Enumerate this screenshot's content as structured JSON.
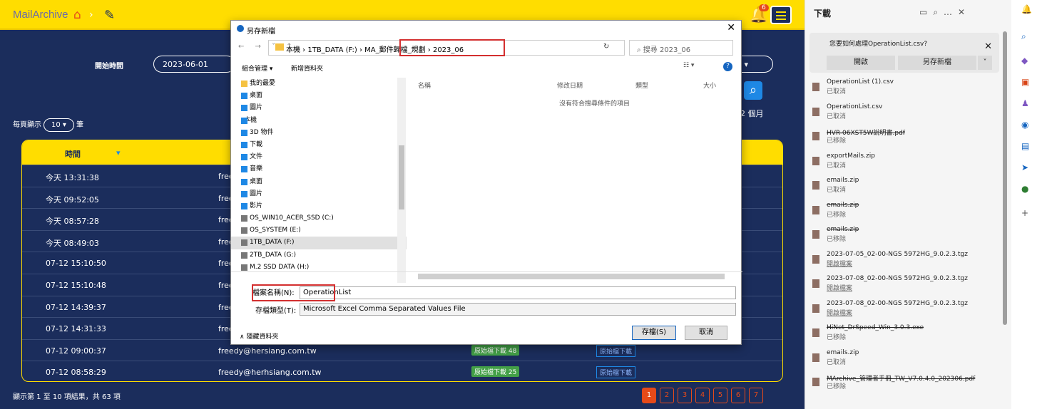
{
  "app": {
    "brand": "MailArchive",
    "notif_count": "6",
    "start_label": "開始時間",
    "start_date": "2023-06-01",
    "right_sel": "0",
    "months": "2 個月",
    "perpage_prefix": "每頁顯示",
    "perpage_value": "10",
    "perpage_suffix": "筆",
    "col_time": "時間",
    "rows": [
      {
        "time": "今天 13:31:38",
        "from": "free",
        "b1": "",
        "b2": ""
      },
      {
        "time": "今天 09:52:05",
        "from": "free",
        "b1": "",
        "b2": ""
      },
      {
        "time": "今天 08:57:28",
        "from": "free",
        "b1": "",
        "b2": ""
      },
      {
        "time": "今天 08:49:03",
        "from": "free",
        "b1": "",
        "b2": ""
      },
      {
        "time": "07-12 15:10:50",
        "from": "free",
        "b1": "",
        "b2": ""
      },
      {
        "time": "07-12 15:10:48",
        "from": "free",
        "b1": "",
        "b2": ""
      },
      {
        "time": "07-12 14:39:37",
        "from": "free",
        "b1": "",
        "b2": ""
      },
      {
        "time": "07-12 14:31:33",
        "from": "free",
        "b1": "",
        "b2": ""
      },
      {
        "time": "07-12 09:00:37",
        "from": "freedy@hersiang.com.tw",
        "b1": "原始檔下載 48",
        "b2": "原始檔下載"
      },
      {
        "time": "07-12 08:58:29",
        "from": "freedy@herhsiang.com.tw",
        "b1": "原始檔下載 25",
        "b2": "原始檔下載"
      }
    ],
    "footer": "顯示第 1 至 10 項結果，共 63 項",
    "pages": [
      "1",
      "2",
      "3",
      "4",
      "5",
      "6",
      "7"
    ]
  },
  "dialog": {
    "title": "另存新檔",
    "path": "本機 › 1TB_DATA (F:) › MA_郵件歸檔_規劃 › 2023_06",
    "search": "搜尋 2023_06",
    "organize": "組合管理 ▾",
    "new_folder": "新增資料夾",
    "tree": [
      "我的最愛",
      "桌面",
      "圖片",
      "本機",
      "3D 物件",
      "下載",
      "文件",
      "音樂",
      "桌面",
      "圖片",
      "影片",
      "OS_WIN10_ACER_SSD (C:)",
      "OS_SYSTEM (E:)",
      "1TB_DATA (F:)",
      "2TB_DATA (G:)",
      "M.2 SSD DATA (H:)"
    ],
    "col_name": "名稱",
    "col_date": "修改日期",
    "col_type": "類型",
    "col_size": "大小",
    "empty": "沒有符合搜尋條件的項目",
    "fname_label": "檔案名稱(N):",
    "fname": "OperationList",
    "ftype_label": "存檔類型(T):",
    "ftype": "Microsoft Excel Comma Separated Values File",
    "hide": "∧ 隱藏資料夾",
    "save": "存檔(S)",
    "cancel": "取消"
  },
  "downloads": {
    "title": "下載",
    "prompt": "您要如何處理OperationList.csv?",
    "open": "開啟",
    "saveas": "另存新檔",
    "items": [
      {
        "name": "OperationList (1).csv",
        "status": "已取消"
      },
      {
        "name": "OperationList.csv",
        "status": "已取消"
      },
      {
        "name": "HVR-06XST5W說明書.pdf",
        "status": "已移除"
      },
      {
        "name": "exportMails.zip",
        "status": "已取消"
      },
      {
        "name": "emails.zip",
        "status": "已取消"
      },
      {
        "name": "emails.zip",
        "status": "已移除"
      },
      {
        "name": "emails.zip",
        "status": "已移除"
      },
      {
        "name": "2023-07-05_02-00-NGS 5972HG_9.0.2.3.tgz",
        "status": "開啟檔案"
      },
      {
        "name": "2023-07-08_02-00-NGS 5972HG_9.0.2.3.tgz",
        "status": "開啟檔案"
      },
      {
        "name": "2023-07-08_02-00-NGS 5972HG_9.0.2.3.tgz",
        "status": "開啟檔案"
      },
      {
        "name": "HiNet_DrSpeed_Win_3.0.3.exe",
        "status": "已移除"
      },
      {
        "name": "emails.zip",
        "status": "已取消"
      },
      {
        "name": "MArchive_管理者手冊_TW_V7.0.4.0_202306.pdf",
        "status": "已移除"
      }
    ]
  }
}
